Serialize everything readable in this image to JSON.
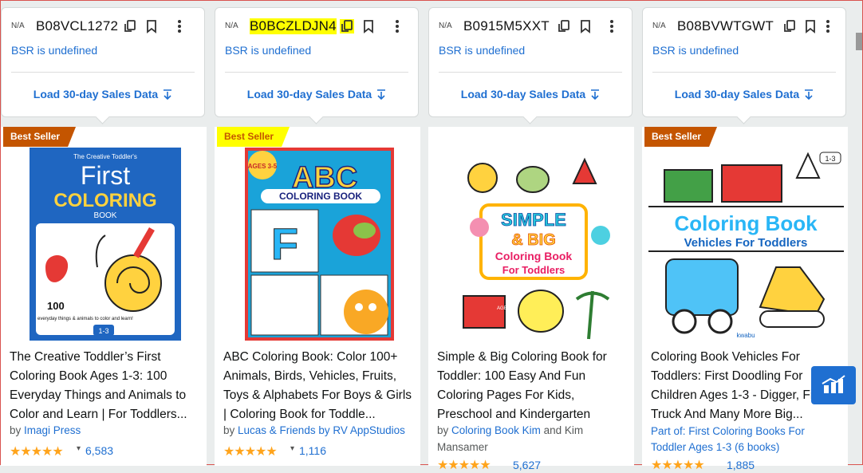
{
  "cards": [
    {
      "na": "N/A",
      "asin": "B08VCL1272",
      "bsr": "BSR is undefined",
      "load": "Load 30-day Sales Data"
    },
    {
      "na": "N/A",
      "asin": "B0BCZLDJN4",
      "bsr": "BSR is undefined",
      "load": "Load 30-day Sales Data"
    },
    {
      "na": "N/A",
      "asin": "B0915M5XXT",
      "bsr": "BSR is undefined",
      "load": "Load 30-day Sales Data"
    },
    {
      "na": "N/A",
      "asin": "B08BVWTGWT",
      "bsr": "BSR is undefined",
      "load": "Load 30-day Sales Data"
    }
  ],
  "products": [
    {
      "badge": "Best Seller",
      "title": "The Creative Toddler’s First Coloring Book Ages 1-3: 100 Everyday Things and Animals to Color and Learn | For Toddlers...",
      "by": "by",
      "author": "Imagi Press",
      "rating_count": "6,583",
      "cover": {
        "top": "The Creative Toddler's",
        "line1": "First",
        "line2": "COLORING",
        "line3": "BOOK",
        "count": "100",
        "sub": "everyday things & animals to color and learn!",
        "age": "1-3"
      }
    },
    {
      "badge": "Best Seller",
      "title": "ABC Coloring Book: Color 100+ Animals, Birds, Vehicles, Fruits, Toys & Alphabets For Boys & Girls | Coloring Book for Toddle...",
      "by": "by",
      "author": "Lucas & Friends by RV AppStudios",
      "rating_count": "1,116",
      "cover": {
        "age": "AGES 3-5",
        "line1": "ABC",
        "line2": "COLORING BOOK",
        "letter": "F"
      }
    },
    {
      "badge": "",
      "title": "Simple & Big Coloring Book for Toddler: 100 Easy And Fun Coloring Pages For Kids, Preschool and Kindergarten",
      "by": "by",
      "author": "Coloring Book Kim",
      "and": "and Kim",
      "author2": "Mansamer",
      "rating_count": "5,627",
      "cover": {
        "line1": "SIMPLE",
        "line2": "& BIG",
        "line3": "Coloring Book",
        "line4": "For Toddlers",
        "age": "AGES 1-4"
      }
    },
    {
      "badge": "Best Seller",
      "title": "Coloring Book Vehicles For Toddlers: First Doodling For Children Ages 1-3 - Digger, Fire Truck And Many More Big...",
      "part": "Part of: First Coloring Books For Toddler Ages 1-3 (6 books)",
      "rating_count": "1,885",
      "cover": {
        "line1": "Coloring Book",
        "line2": "Vehicles For Toddlers",
        "age": "1-3",
        "brand": "kwabu"
      }
    }
  ],
  "stars": "★★★★★",
  "icons": [
    "copy-icon",
    "bookmark-icon",
    "more-vertical-icon",
    "download-arrow-icon",
    "chart-widget-icon"
  ]
}
